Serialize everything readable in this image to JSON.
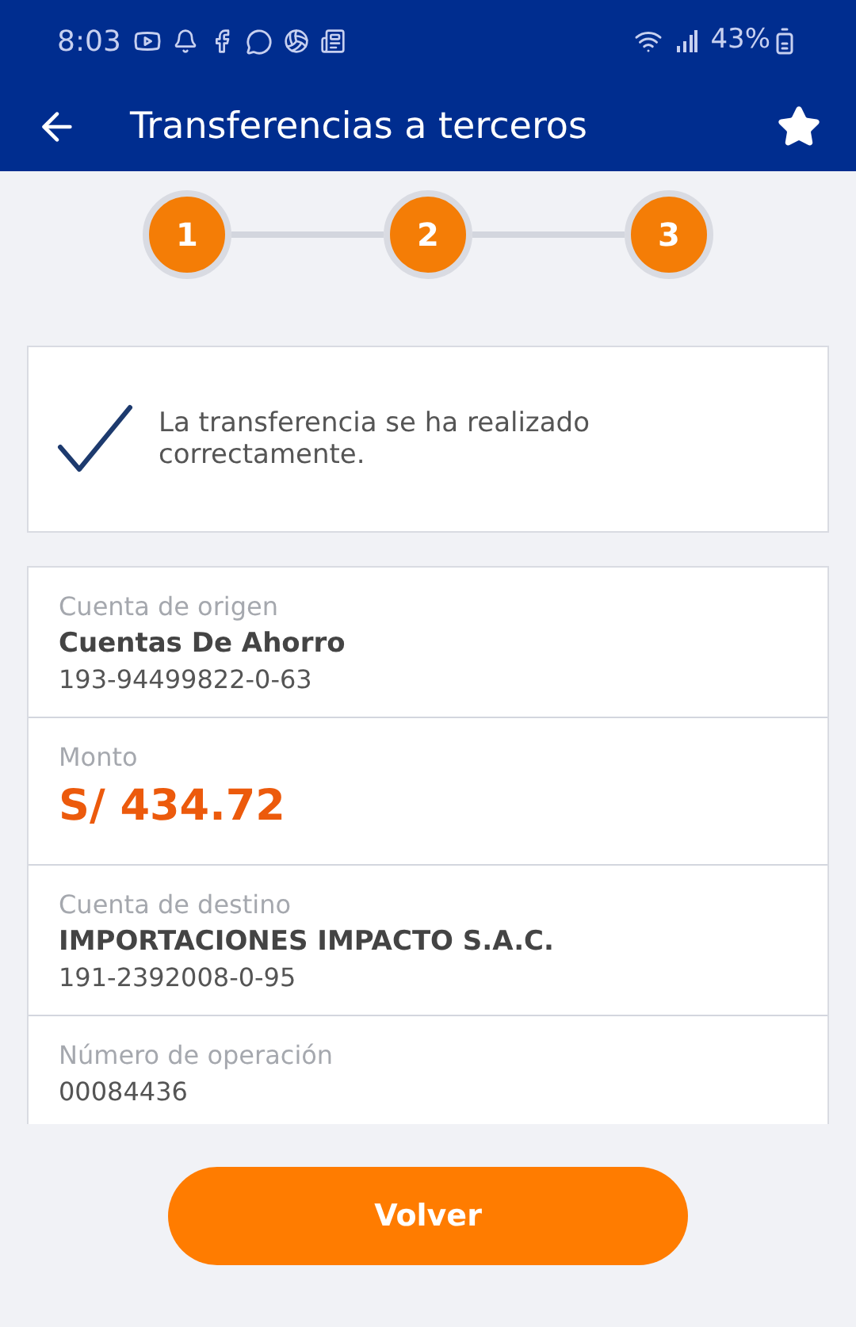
{
  "status_bar": {
    "time": "8:03",
    "battery": "43%"
  },
  "app_bar": {
    "title": "Transferencias a terceros"
  },
  "steps": [
    {
      "label": "1"
    },
    {
      "label": "2"
    },
    {
      "label": "3"
    }
  ],
  "success_message": "La transferencia se ha realizado correctamente.",
  "details": [
    {
      "kind": "account",
      "label": "Cuenta de origen",
      "name": "Cuentas De Ahorro",
      "number": "193-94499822-0-63"
    },
    {
      "kind": "amount",
      "label": "Monto",
      "value": "S/ 434.72"
    },
    {
      "kind": "account",
      "label": "Cuenta de destino",
      "name": "IMPORTACIONES IMPACTO S.A.C.",
      "number": "191-2392008-0-95"
    },
    {
      "kind": "plain",
      "label": "Número de operación",
      "value": "00084436"
    }
  ],
  "primary_button": "Volver"
}
